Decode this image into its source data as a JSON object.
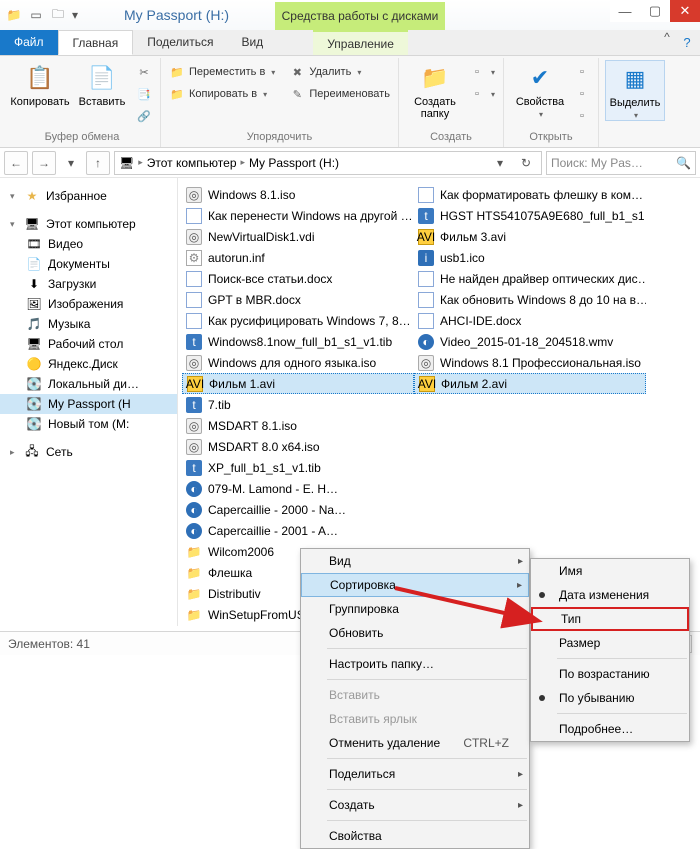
{
  "window": {
    "title": "My Passport (H:)",
    "context_tab": "Средства работы с дисками"
  },
  "tabs": {
    "file": "Файл",
    "main": "Главная",
    "share": "Поделиться",
    "view": "Вид",
    "manage": "Управление"
  },
  "ribbon": {
    "copy": "Копировать",
    "paste": "Вставить",
    "clipboard_group": "Буфер обмена",
    "cut": "",
    "copy_path": "",
    "paste_shortcut": "",
    "move_to": "Переместить в",
    "copy_to": "Копировать в",
    "delete": "Удалить",
    "rename": "Переименовать",
    "organize_group": "Упорядочить",
    "new_folder": "Создать папку",
    "new_group": "Создать",
    "properties": "Свойства",
    "open_group": "Открыть",
    "select": "Выделить",
    "select_group": ""
  },
  "breadcrumb": {
    "root_icon": "🖥",
    "level1": "Этот компьютер",
    "level2": "My Passport (H:)"
  },
  "search": {
    "placeholder": "Поиск: My Pas…"
  },
  "sidebar": {
    "favorites": "Избранное",
    "this_pc": "Этот компьютер",
    "items": [
      {
        "label": "Видео"
      },
      {
        "label": "Документы"
      },
      {
        "label": "Загрузки"
      },
      {
        "label": "Изображения"
      },
      {
        "label": "Музыка"
      },
      {
        "label": "Рабочий стол"
      },
      {
        "label": "Яндекс.Диск"
      },
      {
        "label": "Локальный ди…"
      },
      {
        "label": "My Passport (H"
      },
      {
        "label": "Новый том (M:"
      }
    ],
    "network": "Сеть"
  },
  "files_col1": [
    {
      "icon": "iso",
      "name": "Windows 8.1.iso"
    },
    {
      "icon": "doc",
      "name": "Как перенести Windows на другой …"
    },
    {
      "icon": "iso",
      "name": "NewVirtualDisk1.vdi"
    },
    {
      "icon": "inf",
      "name": "autorun.inf"
    },
    {
      "icon": "doc",
      "name": "Поиск-все статьи.docx"
    },
    {
      "icon": "doc",
      "name": "GPT в MBR.docx"
    },
    {
      "icon": "doc",
      "name": "Как русифицировать Windows 7, 8…"
    },
    {
      "icon": "tib",
      "name": "Windows8.1now_full_b1_s1_v1.tib"
    },
    {
      "icon": "iso",
      "name": "Windows для одного языка.iso"
    },
    {
      "icon": "avi",
      "name": "Фильм 1.avi",
      "selected": true
    },
    {
      "icon": "tib",
      "name": "7.tib"
    },
    {
      "icon": "iso",
      "name": "MSDART 8.1.iso"
    },
    {
      "icon": "iso",
      "name": "MSDART 8.0 x64.iso"
    },
    {
      "icon": "tib",
      "name": "XP_full_b1_s1_v1.tib"
    },
    {
      "icon": "wmv",
      "name": "079-M. Lamond - E. H…"
    },
    {
      "icon": "wmv",
      "name": "Capercaillie - 2000 - Na…"
    },
    {
      "icon": "wmv",
      "name": "Capercaillie - 2001 - A…"
    },
    {
      "icon": "folder",
      "name": "Wilcom2006"
    },
    {
      "icon": "folder",
      "name": "Флешка"
    },
    {
      "icon": "folder",
      "name": "Distributiv"
    },
    {
      "icon": "folder",
      "name": "WinSetupFromUSB-1-…"
    }
  ],
  "files_col2": [
    {
      "icon": "doc",
      "name": "Как форматировать флешку в ком…"
    },
    {
      "icon": "tib",
      "name": "HGST HTS541075A9E680_full_b1_s1…"
    },
    {
      "icon": "avi",
      "name": "Фильм 3.avi"
    },
    {
      "icon": "ico",
      "name": "usb1.ico"
    },
    {
      "icon": "doc",
      "name": "Не найден драйвер оптических дис…"
    },
    {
      "icon": "doc",
      "name": "Как обновить Windows 8 до 10 на в…"
    },
    {
      "icon": "doc",
      "name": "AHCI-IDE.docx"
    },
    {
      "icon": "wmv",
      "name": "Video_2015-01-18_204518.wmv"
    },
    {
      "icon": "iso",
      "name": "Windows 8.1 Профессиональная.iso"
    },
    {
      "icon": "avi",
      "name": "Фильм 2.avi",
      "selected": true
    }
  ],
  "context_menu": {
    "view": "Вид",
    "sort": "Сортировка",
    "group": "Группировка",
    "refresh": "Обновить",
    "customize": "Настроить папку…",
    "paste": "Вставить",
    "paste_shortcut": "Вставить ярлык",
    "undo_delete": "Отменить удаление",
    "undo_shortcut": "CTRL+Z",
    "share": "Поделиться",
    "new": "Создать",
    "properties": "Свойства"
  },
  "sort_menu": {
    "name": "Имя",
    "date": "Дата изменения",
    "type": "Тип",
    "size": "Размер",
    "asc": "По возрастанию",
    "desc": "По убыванию",
    "more": "Подробнее…"
  },
  "status": {
    "count_label": "Элементов:",
    "count": "41"
  }
}
